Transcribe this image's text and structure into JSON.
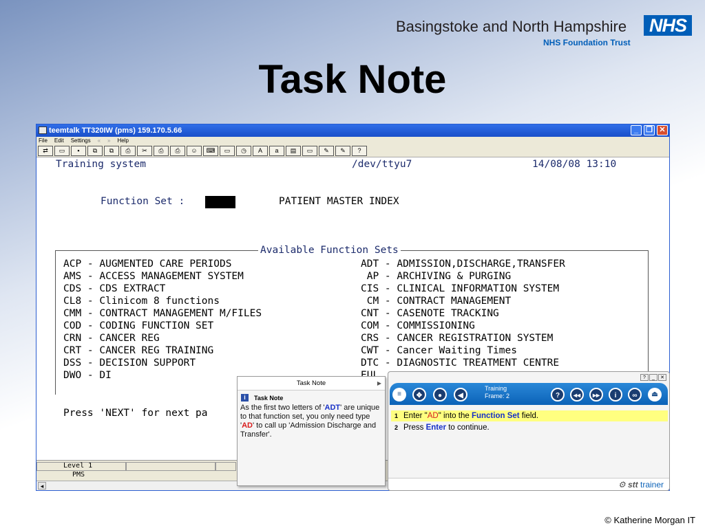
{
  "slide": {
    "title": "Task Note",
    "copyright": "© Katherine Morgan IT",
    "logo": {
      "trust": "Basingstoke and North Hampshire",
      "sub": "NHS Foundation Trust",
      "badge": "NHS"
    },
    "colors": {
      "nhs_blue": "#005eb8"
    }
  },
  "window": {
    "title": "teemtalk TT320IW (pms) 159.170.5.66",
    "menu": [
      "File",
      "Edit",
      "Settings",
      "«",
      "»",
      "Help"
    ],
    "controls": [
      "minimize",
      "restore",
      "close"
    ]
  },
  "terminal": {
    "header_left": "Training system",
    "header_mid": "/dev/ttyu7",
    "header_right": "14/08/08 13:10",
    "function_label": "Function Set :",
    "index_label": "PATIENT MASTER INDEX",
    "legend": "Available Function Sets",
    "left_sets": [
      "ACP - AUGMENTED CARE PERIODS",
      "AMS - ACCESS MANAGEMENT SYSTEM",
      "CDS - CDS EXTRACT",
      "CL8 - Clinicom 8 functions",
      "CMM - CONTRACT MANAGEMENT M/FILES",
      "COD - CODING FUNCTION SET",
      "CRN - CANCER REG",
      "CRT - CANCER REG TRAINING",
      "DSS - DECISION SUPPORT",
      "DWO - DI"
    ],
    "right_sets": [
      "ADT - ADMISSION,DISCHARGE,TRANSFER",
      " AP - ARCHIVING & PURGING",
      "CIS - CLINICAL INFORMATION SYSTEM",
      " CM - CONTRACT MANAGEMENT",
      "CNT - CASENOTE TRACKING",
      "COM - COMMISSIONING",
      "CRS - CANCER REGISTRATION SYSTEM",
      "CWT - Cancer Waiting Times",
      "DTC - DIAGNOSTIC TREATMENT CENTRE",
      "EUL"
    ],
    "press_next": "Press 'NEXT' for next pa",
    "status": {
      "level": "Level 1",
      "app": "PMS"
    }
  },
  "task_note": {
    "header": "Task Note",
    "title": "Task Note",
    "text_1": "As the first two letters of '",
    "code_1": "ADT",
    "text_2": "' are unique to that function set, you only need type '",
    "code_2": "AD",
    "text_3": "' to call up 'Admission Discharge and Transfer'."
  },
  "trainer": {
    "frame_label": "Training",
    "frame_num": "Frame: 2",
    "steps": [
      {
        "num": "1",
        "pre": "Enter \"",
        "code": "AD",
        "mid": "\" into the ",
        "bold": "Function Set",
        "post": " field."
      },
      {
        "num": "2",
        "pre": "Press ",
        "bold": "Enter",
        "post": " to continue."
      }
    ],
    "logo_stt": "stt",
    "logo_trainer": "trainer",
    "colors": {
      "bar": "#0b62b8",
      "highlight": "#ffff80"
    }
  }
}
